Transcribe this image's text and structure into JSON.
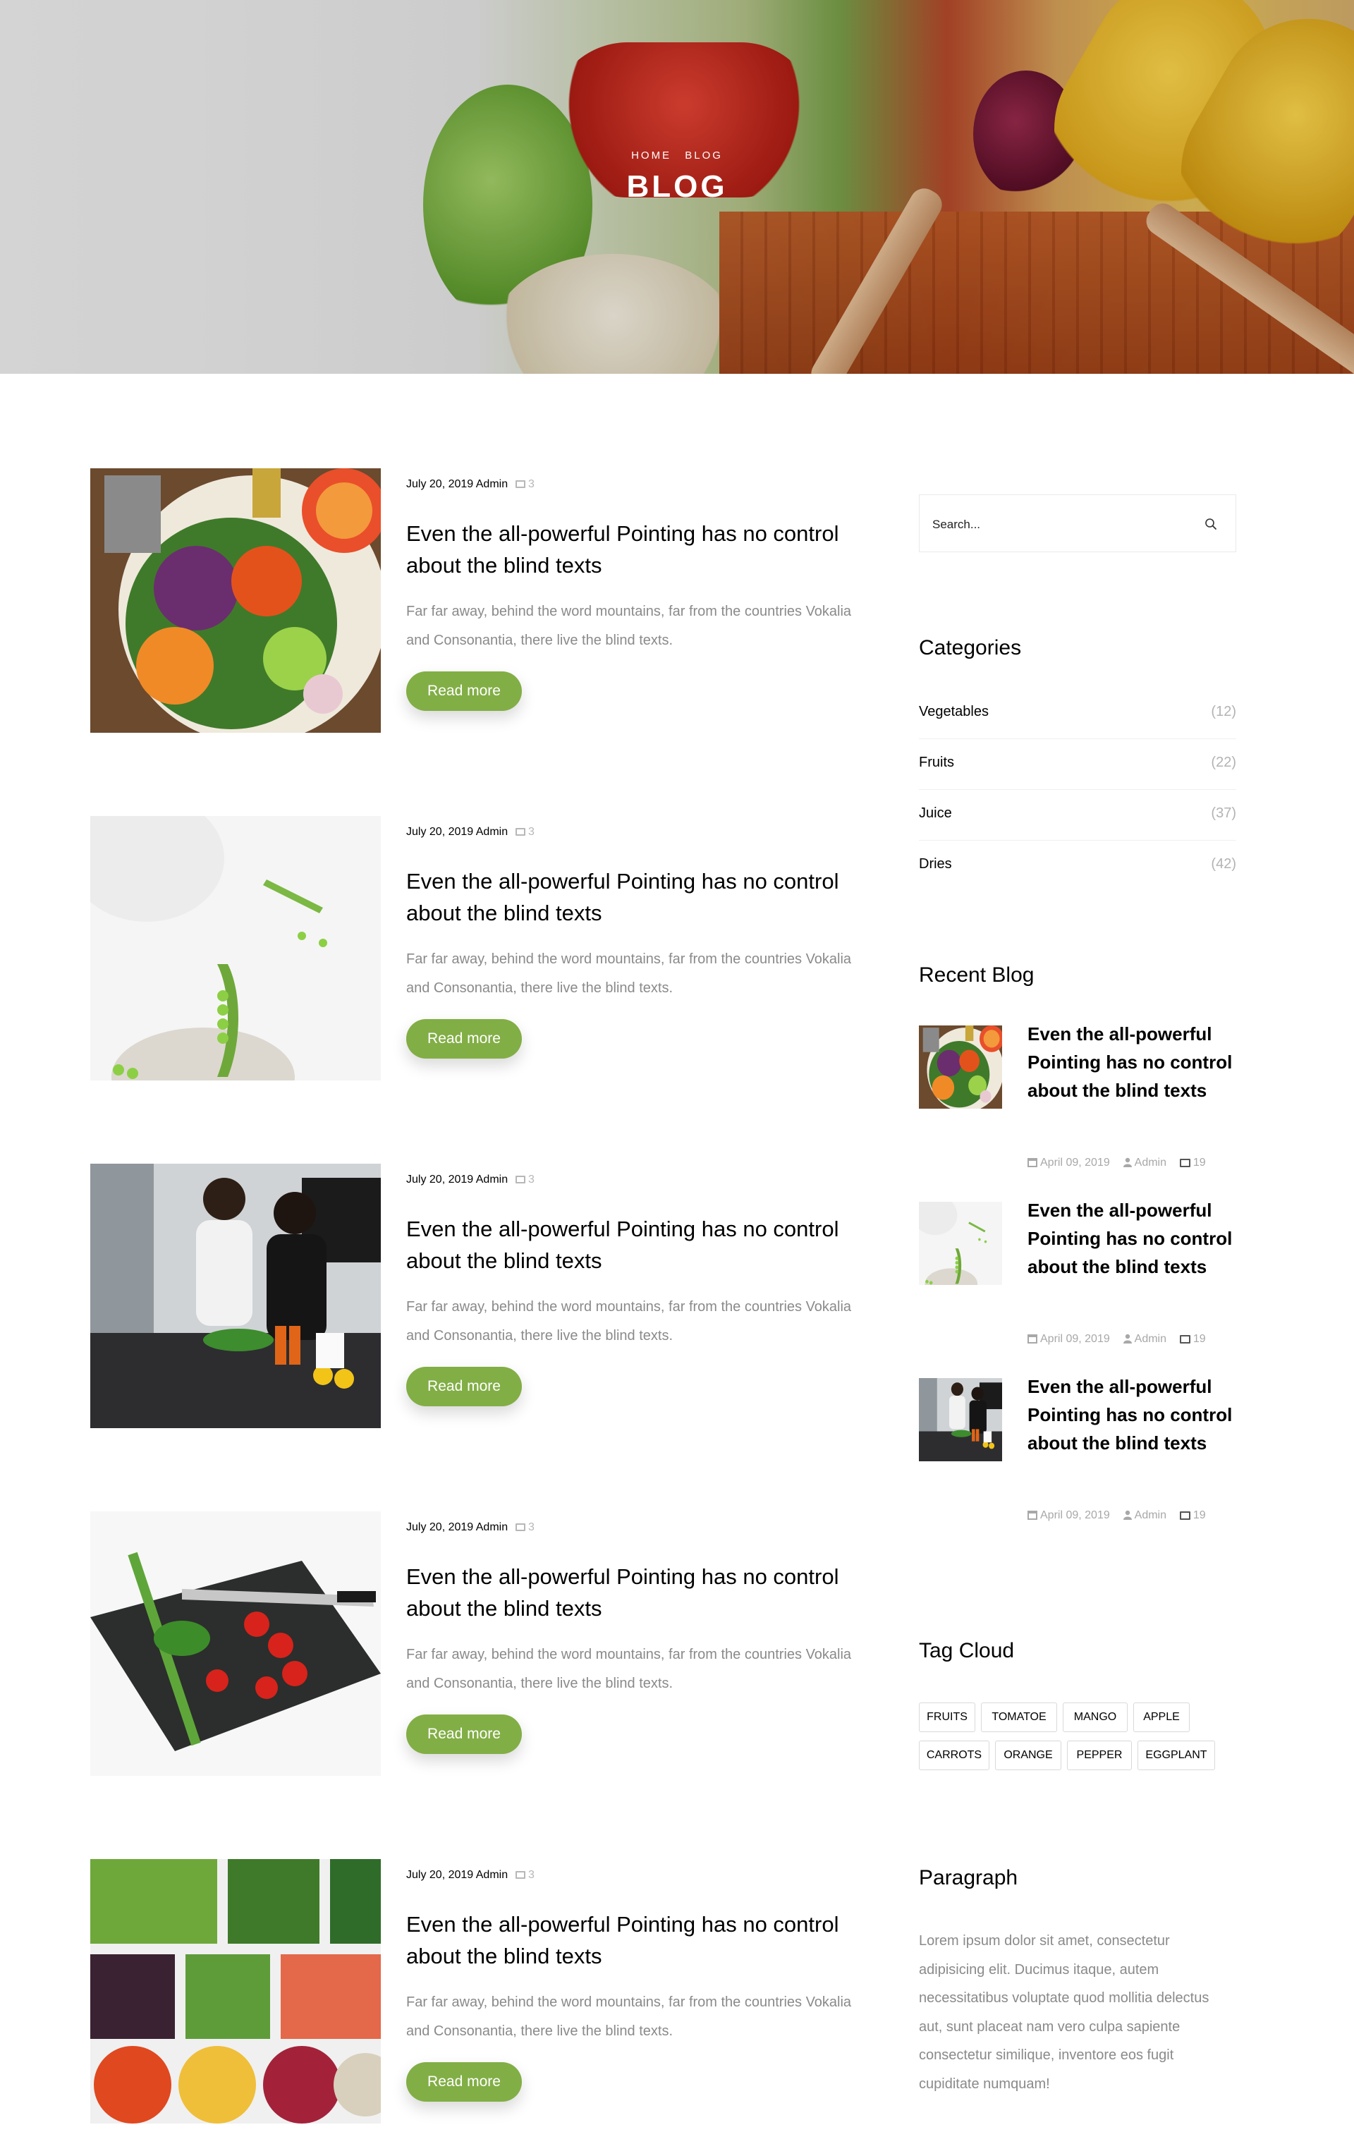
{
  "hero": {
    "breadcrumb_home": "Home",
    "breadcrumb_current": "Blog",
    "title": "BLOG"
  },
  "posts": [
    {
      "date": "July 20, 2019",
      "author": "Admin",
      "comments": "3",
      "title": "Even the all-powerful Pointing has no control about the blind texts",
      "excerpt": "Far far away, behind the word mountains, far from the countries Vokalia and Consonantia, there live the blind texts.",
      "button": "Read more",
      "image": "salad-bowl-image"
    },
    {
      "date": "July 20, 2019",
      "author": "Admin",
      "comments": "3",
      "title": "Even the all-powerful Pointing has no control about the blind texts",
      "excerpt": "Far far away, behind the word mountains, far from the countries Vokalia and Consonantia, there live the blind texts.",
      "button": "Read more",
      "image": "green-peas-image"
    },
    {
      "date": "July 20, 2019",
      "author": "Admin",
      "comments": "3",
      "title": "Even the all-powerful Pointing has no control about the blind texts",
      "excerpt": "Far far away, behind the word mountains, far from the countries Vokalia and Consonantia, there live the blind texts.",
      "button": "Read more",
      "image": "couple-cooking-image"
    },
    {
      "date": "July 20, 2019",
      "author": "Admin",
      "comments": "3",
      "title": "Even the all-powerful Pointing has no control about the blind texts",
      "excerpt": "Far far away, behind the word mountains, far from the countries Vokalia and Consonantia, there live the blind texts.",
      "button": "Read more",
      "image": "tomatoes-cutting-board-image"
    },
    {
      "date": "July 20, 2019",
      "author": "Admin",
      "comments": "3",
      "title": "Even the all-powerful Pointing has no control about the blind texts",
      "excerpt": "Far far away, behind the word mountains, far from the countries Vokalia and Consonantia, there live the blind texts.",
      "button": "Read more",
      "image": "vegetable-bowls-image"
    }
  ],
  "sidebar": {
    "search_placeholder": "Search...",
    "categories_heading": "Categories",
    "categories": [
      {
        "name": "Vegetables",
        "count": "(12)"
      },
      {
        "name": "Fruits",
        "count": "(22)"
      },
      {
        "name": "Juice",
        "count": "(37)"
      },
      {
        "name": "Dries",
        "count": "(42)"
      }
    ],
    "recent_heading": "Recent Blog",
    "recent": [
      {
        "title": "Even the all-powerful Pointing has no control about the blind texts",
        "date": "April 09, 2019",
        "author": "Admin",
        "comments": "19",
        "image": "salad-bowl-thumb"
      },
      {
        "title": "Even the all-powerful Pointing has no control about the blind texts",
        "date": "April 09, 2019",
        "author": "Admin",
        "comments": "19",
        "image": "green-peas-thumb"
      },
      {
        "title": "Even the all-powerful Pointing has no control about the blind texts",
        "date": "April 09, 2019",
        "author": "Admin",
        "comments": "19",
        "image": "couple-cooking-thumb"
      }
    ],
    "tag_heading": "Tag Cloud",
    "tags": [
      "fruits",
      "tomatoe",
      "mango",
      "apple",
      "carrots",
      "orange",
      "pepper",
      "eggplant"
    ],
    "paragraph_heading": "Paragraph",
    "paragraph_text": "Lorem ipsum dolor sit amet, consectetur adipisicing elit. Ducimus itaque, autem necessitatibus voluptate quod mollitia delectus aut, sunt placeat nam vero culpa sapiente consectetur similique, inventore eos fugit cupiditate numquam!"
  },
  "colors": {
    "accent": "#82ae46",
    "muted_text": "#8a8a8a",
    "border": "#eaeaea"
  }
}
